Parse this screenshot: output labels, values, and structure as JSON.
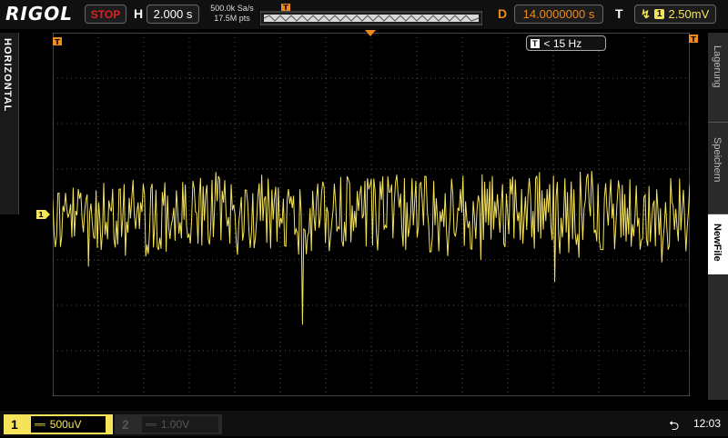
{
  "brand": "RIGOL",
  "status": "STOP",
  "horizontal": {
    "label": "H",
    "timebase": "2.000 s"
  },
  "acquisition": {
    "sample_rate": "500.0k Sa/s",
    "memory_depth": "17.5M pts"
  },
  "delay": {
    "label": "D",
    "value": "14.0000000 s"
  },
  "trigger": {
    "label": "T",
    "source": "1",
    "level": "2.50mV"
  },
  "left_tab": {
    "label": "HORIZONTAL"
  },
  "frequency_counter": {
    "value": "< 15 Hz"
  },
  "right_menu": [
    {
      "label": "Lagerung",
      "active": false
    },
    {
      "label": "Speichern",
      "active": false
    },
    {
      "label": "NewFile",
      "active": true
    }
  ],
  "channel1": {
    "number": "1",
    "coupling": "DC",
    "scale": "500uV",
    "color": "#f5e35a"
  },
  "channel2": {
    "number": "2",
    "coupling": "DC",
    "scale": "1.00V"
  },
  "clock": "12:03",
  "colors": {
    "trace": "#f5e35a",
    "trigger": "#f08a1a",
    "stop": "#e02020"
  },
  "icons": {
    "trigger_edge": "rising-edge-icon",
    "usb": "usb-icon"
  }
}
